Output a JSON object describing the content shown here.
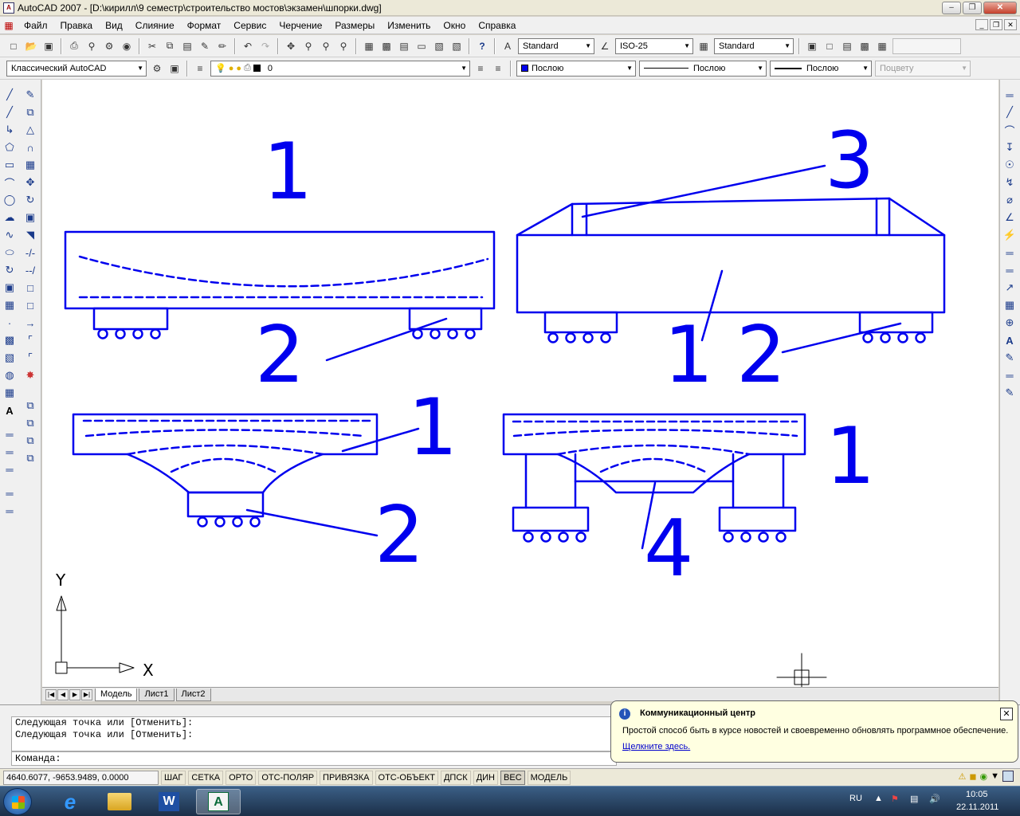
{
  "window": {
    "title": "AutoCAD 2007 - [D:\\кирилл\\9 семестр\\строительство мостов\\экзамен\\шпорки.dwg]",
    "app_icon": "A"
  },
  "menu": [
    "Файл",
    "Правка",
    "Вид",
    "Слияние",
    "Формат",
    "Сервис",
    "Черчение",
    "Размеры",
    "Изменить",
    "Окно",
    "Справка"
  ],
  "toolbar1": {
    "text_style": "Standard",
    "dim_style": "ISO-25",
    "table_style": "Standard"
  },
  "toolbar2": {
    "workspace": "Классический AutoCAD",
    "layer": "0",
    "color": "Послою",
    "linetype": "Послою",
    "lineweight": "Послою",
    "plotstyle": "Поцвету",
    "accent_color": "#0000ee"
  },
  "drawing": {
    "stroke_color": "#0000ee",
    "labels": {
      "d1_top": "1",
      "d1_bottom": "2",
      "d2_top": "3",
      "d2_mid": "1",
      "d2_bottom": "2",
      "d3_right": "1",
      "d3_bottom": "2",
      "d4_right": "1",
      "d4_bottom": "4"
    },
    "ucs": {
      "x": "X",
      "y": "Y"
    }
  },
  "layout_tabs": [
    "Модель",
    "Лист1",
    "Лист2"
  ],
  "command": {
    "history": [
      "Следующая точка или [Отменить]:",
      "Следующая точка или [Отменить]:"
    ],
    "prompt": "Команда:"
  },
  "status": {
    "coords": "4640.6077, -9653.9489, 0.0000",
    "buttons": [
      "ШАГ",
      "СЕТКА",
      "ОРТО",
      "ОТС-ПОЛЯР",
      "ПРИВЯЗКА",
      "ОТС-ОБЪЕКТ",
      "ДПСК",
      "ДИН",
      "ВЕС",
      "МОДЕЛЬ"
    ]
  },
  "balloon": {
    "title": "Коммуникационный центр",
    "text": "Простой способ быть в курсе новостей и своевременно обновлять программное обеспечение.",
    "link": "Щелкните здесь."
  },
  "taskbar": {
    "lang": "RU",
    "time": "10:05",
    "date": "22.11.2011"
  }
}
